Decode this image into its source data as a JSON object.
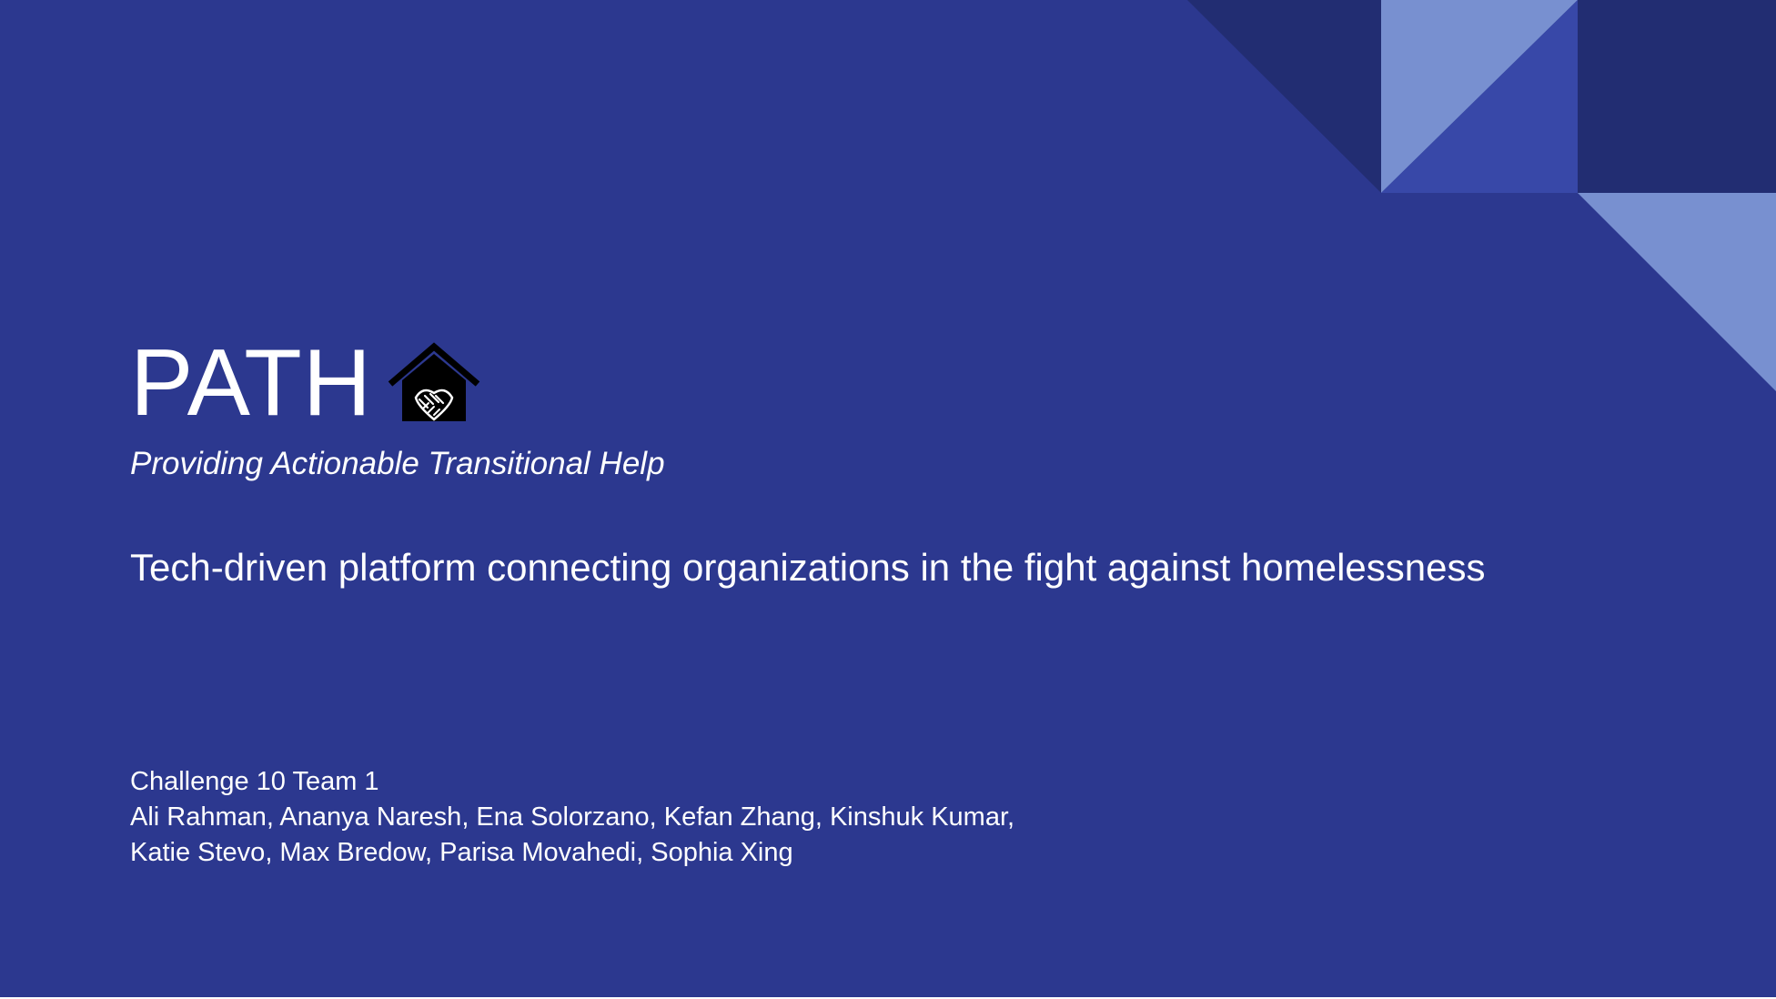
{
  "slide": {
    "title": "PATH",
    "tagline": "Providing Actionable Transitional Help",
    "subtitle": "Tech-driven platform connecting organizations in the fight against homelessness",
    "team_name": "Challenge 10 Team 1",
    "members_line_1": "Ali Rahman, Ananya Naresh, Ena Solorzano, Kefan Zhang, Kinshuk Kumar,",
    "members_line_2": "Katie Stevo, Max Bredow, Parisa Movahedi, Sophia Xing"
  },
  "logo": {
    "icon": "house-handshake-icon"
  },
  "colors": {
    "background": "#2c388f",
    "shape_dark": "#222d72",
    "shape_light": "#7890d0",
    "shape_mid": "#3848a8",
    "text": "#ffffff",
    "logo_black": "#000000"
  }
}
